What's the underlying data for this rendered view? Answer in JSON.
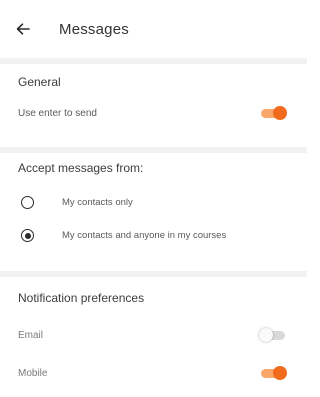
{
  "header": {
    "back_icon": "arrow-left-icon",
    "title": "Messages"
  },
  "general": {
    "heading": "General",
    "enter_to_send": {
      "label": "Use enter to send",
      "enabled": true
    }
  },
  "accept_messages": {
    "heading": "Accept messages from:",
    "options": [
      {
        "label": "My contacts only",
        "selected": false
      },
      {
        "label": "My contacts and anyone in my courses",
        "selected": true
      }
    ]
  },
  "notifications": {
    "heading": "Notification preferences",
    "email": {
      "label": "Email",
      "enabled": false
    },
    "mobile": {
      "label": "Mobile",
      "enabled": true
    }
  },
  "colors": {
    "accent": "#f26b1d",
    "accent_track": "#f9a66a",
    "divider": "#f2f2f2"
  }
}
